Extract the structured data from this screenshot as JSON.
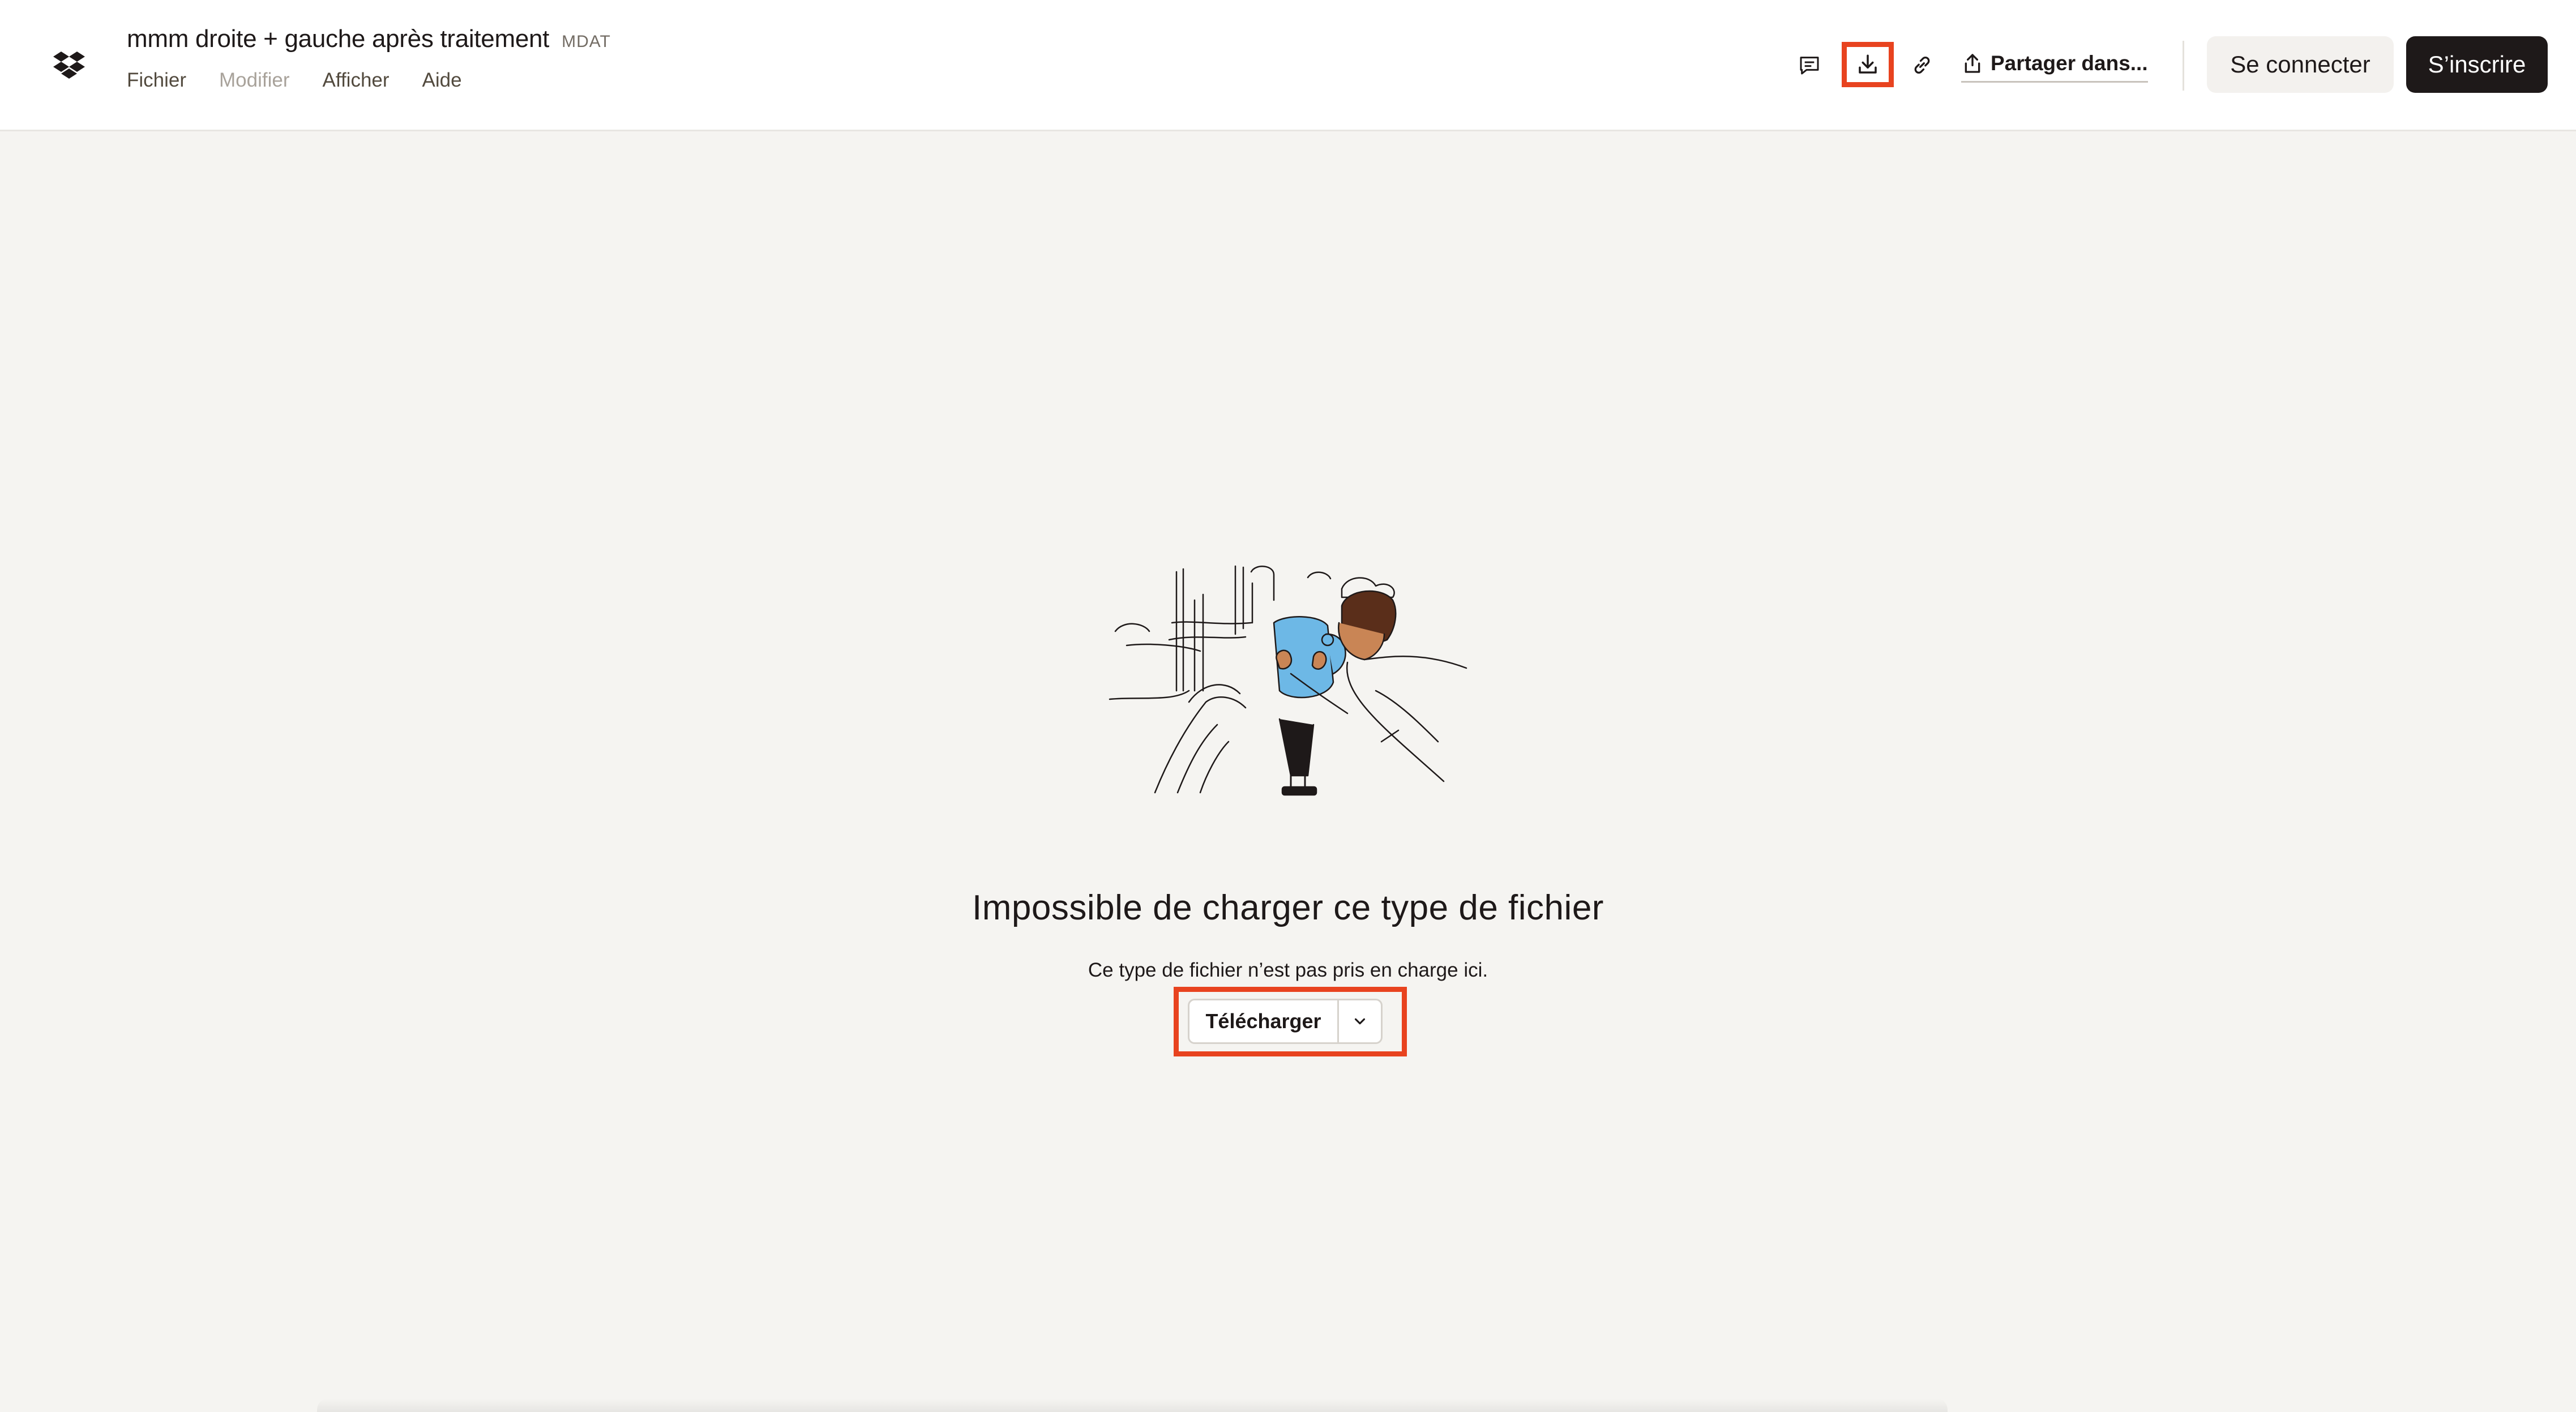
{
  "header": {
    "logo_icon": "dropbox-logo-icon",
    "doc_title": "mmm droite + gauche après traitement",
    "doc_ext": "MDAT",
    "menu": [
      {
        "label": "Fichier",
        "enabled": true
      },
      {
        "label": "Modifier",
        "enabled": false
      },
      {
        "label": "Afficher",
        "enabled": true
      },
      {
        "label": "Aide",
        "enabled": true
      }
    ],
    "toolbar": {
      "comment_icon": "comment-icon",
      "download_icon": "download-icon",
      "link_icon": "link-icon",
      "share_icon": "share-icon",
      "share_label": "Partager dans...",
      "login_label": "Se connecter",
      "signup_label": "S’inscrire"
    }
  },
  "main": {
    "illustration": "person-looking-through-binoculars-illustration",
    "error_title": "Impossible de charger ce type de fichier",
    "error_subtitle": "Ce type de fichier n’est pas pris en charge ici.",
    "download_label": "Télécharger",
    "dropdown_icon": "chevron-down-icon"
  },
  "colors": {
    "highlight": "#e8431f",
    "background": "#f5f4f1",
    "primary_button": "#1e1919",
    "binocular_blue": "#6db8e6"
  }
}
